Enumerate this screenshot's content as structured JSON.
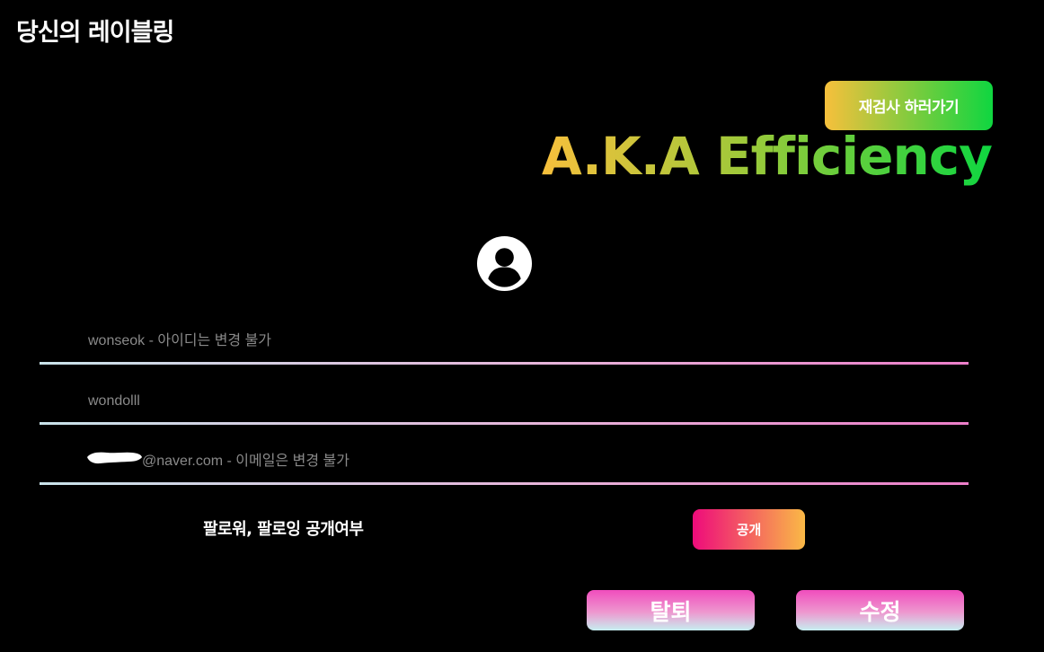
{
  "header": {
    "title": "당신의 레이블링"
  },
  "profile": {
    "retest_label": "재검사 하러가기",
    "aka": "A.K.A Efficiency",
    "avatar_icon": "user-circle-icon"
  },
  "form": {
    "id_field": {
      "value": "",
      "placeholder": "wonseok - 아이디는 변경 불가"
    },
    "nickname_field": {
      "value": "",
      "placeholder": "wondolll"
    },
    "email_field": {
      "value": "",
      "placeholder": "@naver.com - 이메일은 변경 불가"
    }
  },
  "privacy": {
    "label": "팔로워, 팔로잉 공개여부",
    "toggle_label": "공개"
  },
  "actions": {
    "withdraw_label": "탈퇴",
    "edit_label": "수정"
  },
  "colors": {
    "background": "#000000",
    "accent_yellow": "#f7c03c",
    "accent_green": "#0fd640",
    "accent_pink": "#ee0b7b",
    "accent_orange": "#fab946"
  }
}
